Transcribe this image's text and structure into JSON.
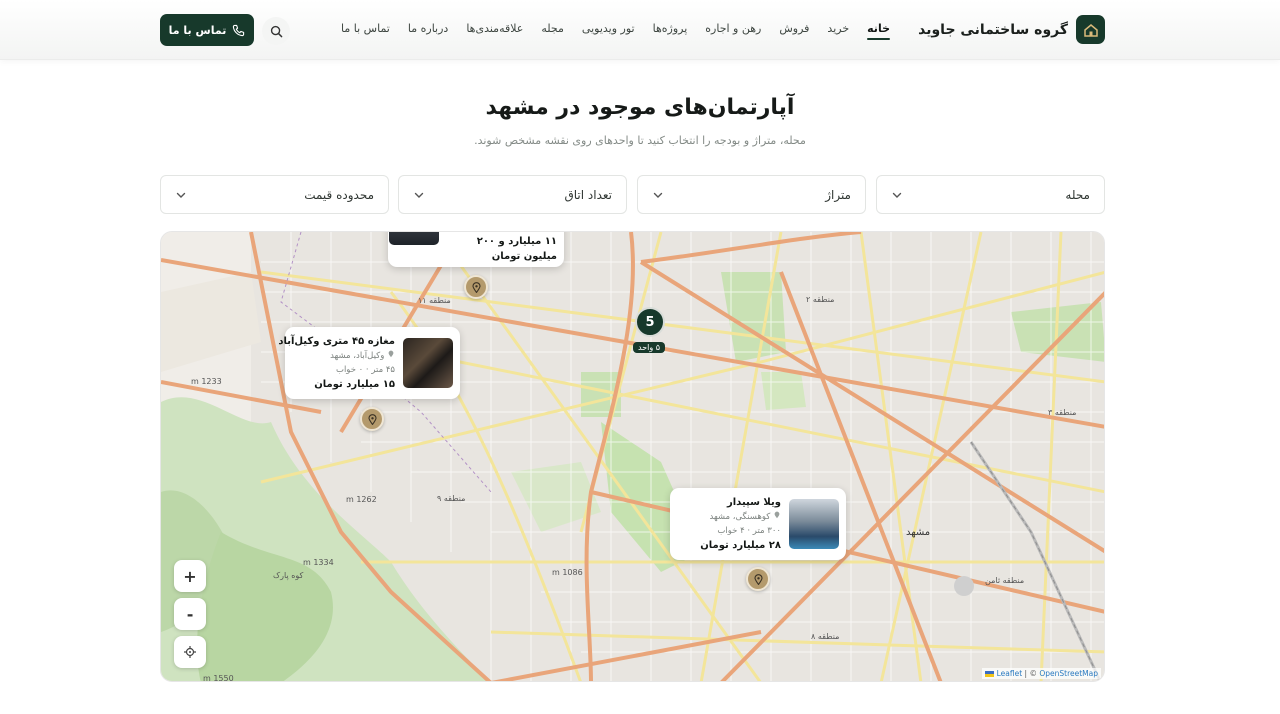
{
  "brand": {
    "name": "گروه ساختمانی جاوید"
  },
  "nav": [
    {
      "label": "خانه",
      "active": true
    },
    {
      "label": "خرید"
    },
    {
      "label": "فروش"
    },
    {
      "label": "رهن و اجاره"
    },
    {
      "label": "پروژه‌ها"
    },
    {
      "label": "تور ویدیویی"
    },
    {
      "label": "مجله"
    },
    {
      "label": "علاقه‌مندی‌ها"
    },
    {
      "label": "درباره ما"
    },
    {
      "label": "تماس با ما"
    }
  ],
  "header": {
    "contact_label": "تماس با ما",
    "search_icon": "search-icon",
    "phone_icon": "phone-icon"
  },
  "page": {
    "title": "آپارتمان‌های موجود در مشهد",
    "subtitle": "محله، متراژ و بودجه را انتخاب کنید تا واحدهای روی نقشه مشخص شوند."
  },
  "filters": [
    {
      "label": "محله"
    },
    {
      "label": "متراژ"
    },
    {
      "label": "تعداد اتاق"
    },
    {
      "label": "محدوده قیمت"
    }
  ],
  "map": {
    "popups": [
      {
        "title": "",
        "location": "",
        "meta": "",
        "price": "۱۱ میلیارد و ۲۰۰ میلیون تومان"
      },
      {
        "title": "مغازه ۴۵ متری وکیل‌آباد",
        "location": "وکیل‌آباد، مشهد",
        "meta": "۴۵ متر · ۰ خواب",
        "price": "۱۵ میلیارد تومان"
      },
      {
        "title": "ویلا سپیدار",
        "location": "کوهسنگی، مشهد",
        "meta": "۳۰۰ متر · ۴ خواب",
        "price": "۲۸ میلیارد تومان"
      }
    ],
    "cluster": {
      "count": "5",
      "label": "۵ واحد"
    },
    "labels": {
      "region11": "منطقه ۱۱",
      "region2": "منطقه ۲",
      "region3": "منطقه ۳",
      "region9": "منطقه ۹",
      "region8": "منطقه ۸",
      "samen": "منطقه ثامن",
      "mashhad": "مشهد",
      "koh": "کوه پارک",
      "alt1": "1233 m",
      "alt2": "1262 m",
      "alt3": "1086 m",
      "alt4": "1334 m",
      "alt5": "1550 m"
    },
    "zoom_in": "+",
    "zoom_out": "-",
    "attribution_leaflet": "Leaflet",
    "attribution_sep": " | © ",
    "attribution_osm": "OpenStreetMap"
  },
  "colors": {
    "primary": "#17392b",
    "pin": "#b49a6c"
  }
}
